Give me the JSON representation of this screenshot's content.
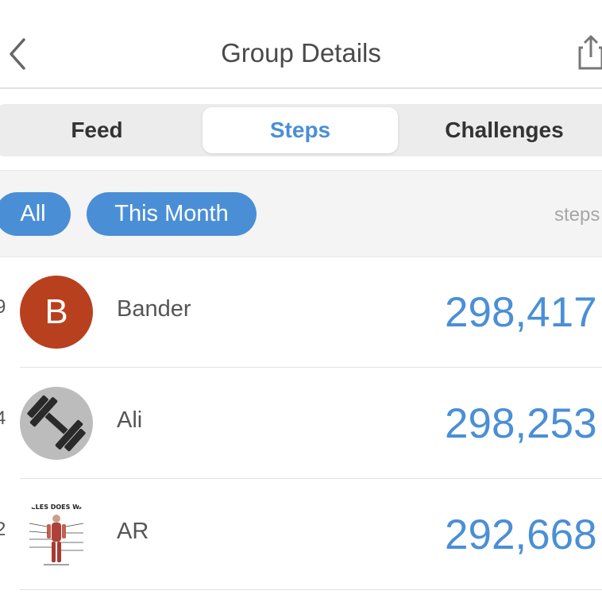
{
  "header": {
    "title": "Group Details",
    "back_icon": "chevron-left-icon",
    "share_icon": "share-icon"
  },
  "tabs": [
    {
      "label": "Feed",
      "active": false
    },
    {
      "label": "Steps",
      "active": true
    },
    {
      "label": "Challenges",
      "active": false
    }
  ],
  "filters": {
    "all_label": "All",
    "this_month_label": "This Month",
    "unit_label": "steps"
  },
  "rows": [
    {
      "rank": "9",
      "avatar_letter": "B",
      "avatar_color": "#b8401f",
      "name": "Bander",
      "steps": "298,417"
    },
    {
      "rank": "4",
      "avatar_icon": "dumbbell-icon",
      "name": "Ali",
      "steps": "298,253"
    },
    {
      "rank": "2",
      "avatar_icon": "muscle-diagram-icon",
      "avatar_caption": "SCLES DOES WALK",
      "name": "AR",
      "steps": "292,668"
    }
  ],
  "colors": {
    "accent": "#4a8fd6",
    "segment_bg": "#ececec",
    "filter_bg": "#f4f4f4"
  }
}
